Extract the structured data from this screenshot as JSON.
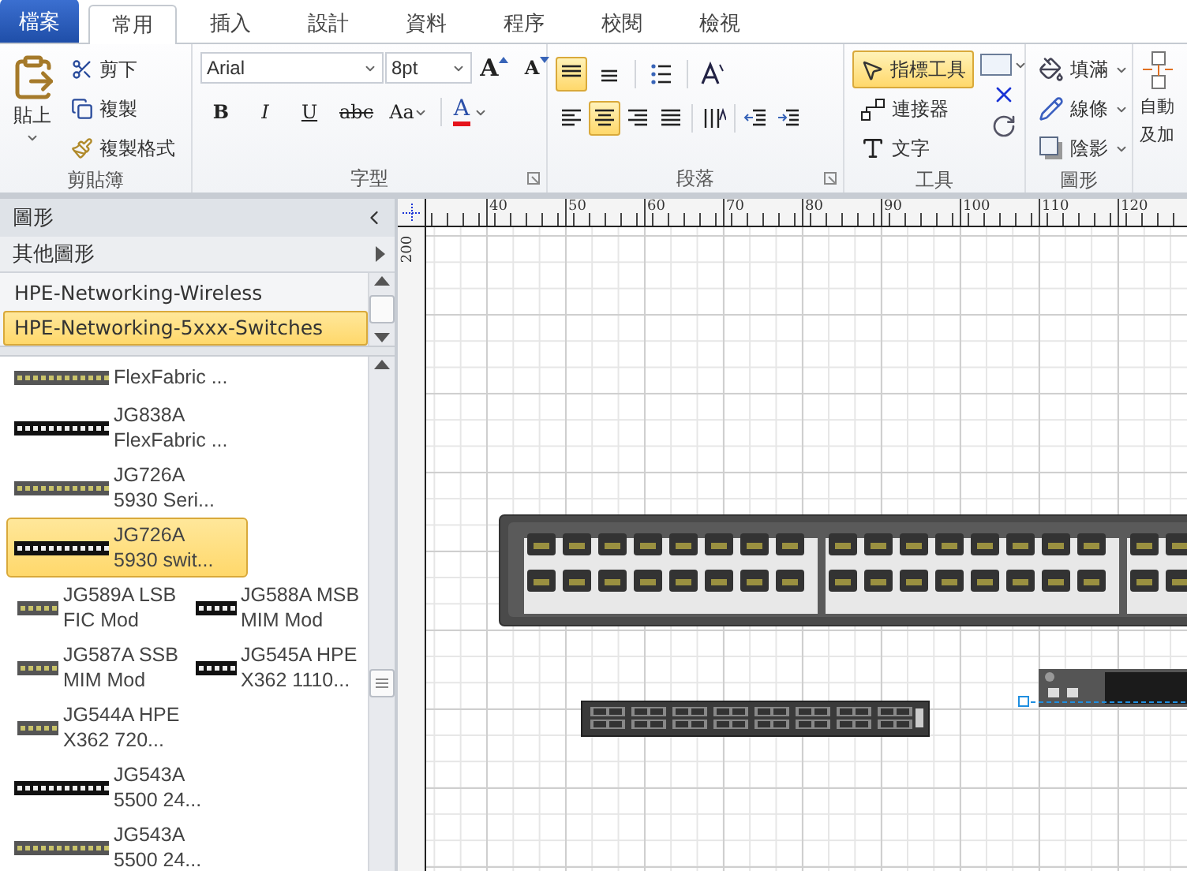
{
  "tabs": [
    {
      "label": "檔案",
      "kind": "file",
      "selected": false
    },
    {
      "label": "常用",
      "kind": "tab",
      "selected": true
    },
    {
      "label": "插入",
      "kind": "tab",
      "selected": false
    },
    {
      "label": "設計",
      "kind": "tab",
      "selected": false
    },
    {
      "label": "資料",
      "kind": "tab",
      "selected": false
    },
    {
      "label": "程序",
      "kind": "tab",
      "selected": false
    },
    {
      "label": "校閱",
      "kind": "tab",
      "selected": false
    },
    {
      "label": "檢視",
      "kind": "tab",
      "selected": false
    }
  ],
  "ribbon": {
    "clipboard": {
      "label": "剪貼簿",
      "paste": "貼上",
      "actions": [
        {
          "label": "剪下",
          "kind": "cut"
        },
        {
          "label": "複製",
          "kind": "copy"
        },
        {
          "label": "複製格式",
          "kind": "format"
        }
      ]
    },
    "font": {
      "label": "字型",
      "font_name": "Arial",
      "font_size": "8pt",
      "size_buttons": [
        {
          "label": "A",
          "kind": "grow"
        },
        {
          "label": "A",
          "kind": "shrink"
        }
      ],
      "styles": [
        {
          "label": "B",
          "kind": "bold"
        },
        {
          "label": "I",
          "kind": "italic"
        },
        {
          "label": "U",
          "kind": "underline"
        },
        {
          "label": "abc",
          "kind": "strike"
        },
        {
          "label": "Aa",
          "kind": "case"
        }
      ],
      "color_button": "A"
    },
    "paragraph": {
      "label": "段落",
      "rows": [
        [
          {
            "kind": "align-top",
            "selected": true
          },
          {
            "kind": "align-middle",
            "selected": false
          },
          {
            "kind": "bullets",
            "selected": false
          },
          {
            "kind": "text-size",
            "selected": false
          }
        ],
        [
          {
            "kind": "align-left",
            "selected": false
          },
          {
            "kind": "align-center",
            "selected": true
          },
          {
            "kind": "align-right",
            "selected": false
          },
          {
            "kind": "justify",
            "selected": false
          },
          {
            "kind": "vertical-text",
            "selected": false
          },
          {
            "kind": "outdent",
            "selected": false
          },
          {
            "kind": "indent",
            "selected": false
          }
        ]
      ]
    },
    "tools": {
      "label": "工具",
      "items": [
        {
          "label": "指標工具",
          "kind": "pointer",
          "selected": true
        },
        {
          "label": "連接器",
          "kind": "connector",
          "selected": false
        },
        {
          "label": "文字",
          "kind": "text",
          "selected": false
        }
      ]
    },
    "shape": {
      "label": "圖形",
      "items": [
        {
          "label": "填滿",
          "kind": "fill"
        },
        {
          "label": "線條",
          "kind": "line"
        },
        {
          "label": "陰影",
          "kind": "shadow"
        }
      ]
    },
    "arrange": {
      "lines": [
        "自動",
        "及加"
      ]
    }
  },
  "shapes_pane": {
    "title": "圖形",
    "more_shapes": "其他圖形",
    "stencils": [
      {
        "label": "HPE-Networking-Wireless",
        "selected": false
      },
      {
        "label": "HPE-Networking-5xxx-Switches",
        "selected": true
      }
    ],
    "shapes": [
      {
        "kind": "wide",
        "lines": [
          "FlexFabric ..."
        ],
        "selected": false
      },
      {
        "kind": "wide",
        "lines": [
          "JG838A",
          "FlexFabric ..."
        ],
        "selected": false
      },
      {
        "kind": "wide",
        "lines": [
          "JG726A",
          "5930 Seri..."
        ],
        "selected": false
      },
      {
        "kind": "wide",
        "lines": [
          "JG726A",
          "5930 swit..."
        ],
        "selected": true
      },
      {
        "kind": "small",
        "lines": [
          "JG589A LSB",
          "FIC Mod"
        ],
        "selected": false
      },
      {
        "kind": "small",
        "lines": [
          "JG588A MSB",
          "MIM Mod"
        ],
        "selected": false
      },
      {
        "kind": "small",
        "lines": [
          "JG587A SSB",
          "MIM Mod"
        ],
        "selected": false
      },
      {
        "kind": "small",
        "lines": [
          "JG545A HPE",
          "X362 1110..."
        ],
        "selected": false
      },
      {
        "kind": "small",
        "lines": [
          "JG544A HPE",
          "X362 720..."
        ],
        "selected": false
      },
      {
        "kind": "wide",
        "lines": [
          "JG543A",
          "5500 24..."
        ],
        "selected": false
      },
      {
        "kind": "wide",
        "lines": [
          "JG543A",
          "5500 24..."
        ],
        "selected": false
      }
    ]
  },
  "ruler": {
    "horizontal": [
      "40",
      "50",
      "60",
      "70",
      "80",
      "90",
      "100",
      "110",
      "120"
    ],
    "vertical": [
      "200"
    ]
  }
}
